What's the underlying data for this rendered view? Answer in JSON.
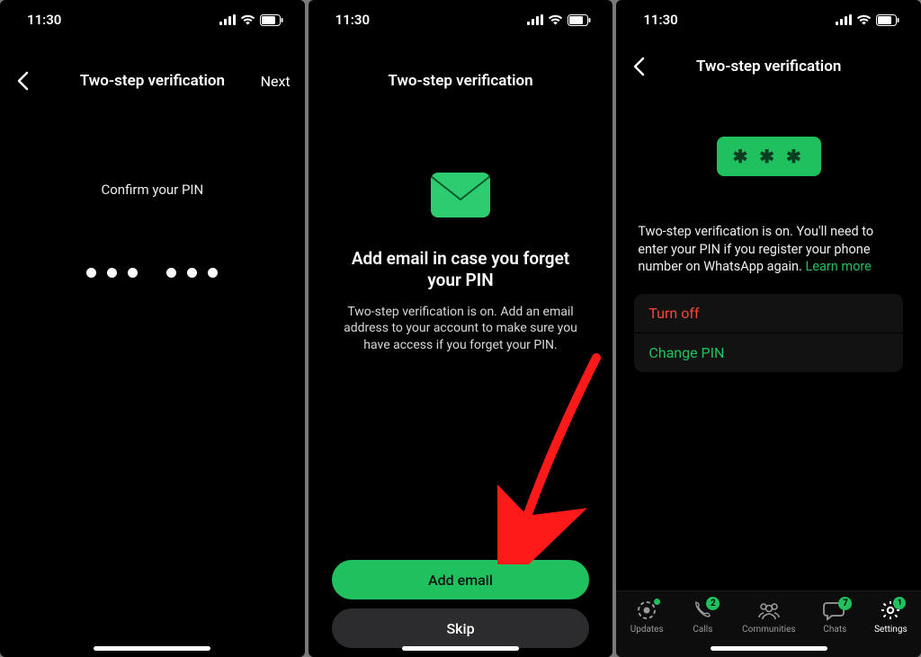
{
  "status": {
    "time": "11:30"
  },
  "screen1": {
    "title": "Two-step verification",
    "next": "Next",
    "confirm": "Confirm your PIN"
  },
  "screen2": {
    "title": "Two-step verification",
    "heading": "Add email in case you forget your PIN",
    "body": "Two-step verification is on. Add an email address to your account to make sure you have access if you forget your PIN.",
    "primary": "Add email",
    "secondary": "Skip"
  },
  "screen3": {
    "title": "Two-step verification",
    "badge": "✱ ✱ ✱",
    "info1": "Two-step verification is on. You'll need to enter your PIN if you register your phone number on WhatsApp again. ",
    "learn": "Learn more",
    "turn_off": "Turn off",
    "change_pin": "Change PIN",
    "tabs": {
      "updates": "Updates",
      "calls": "Calls",
      "calls_badge": "2",
      "communities": "Communities",
      "chats": "Chats",
      "chats_badge": "7",
      "settings": "Settings",
      "settings_badge": "1"
    }
  }
}
